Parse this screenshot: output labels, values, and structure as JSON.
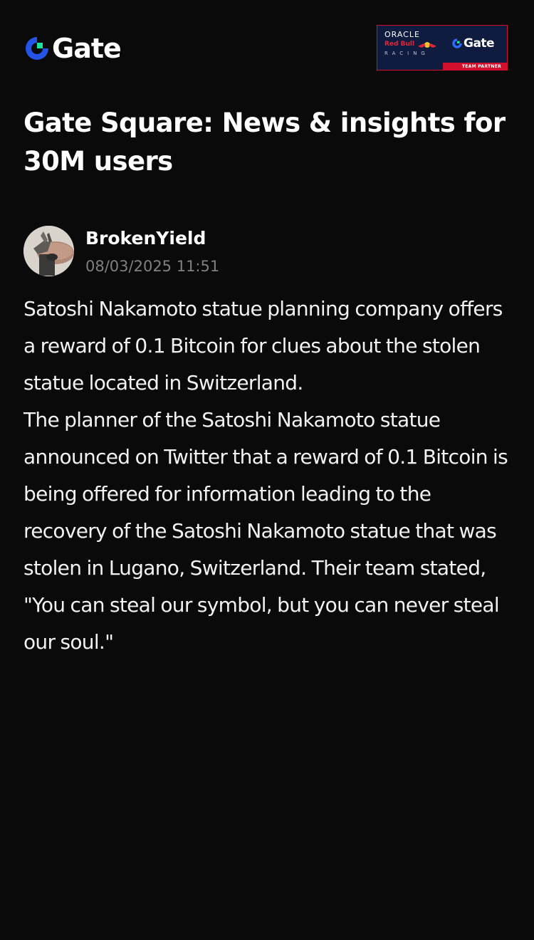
{
  "header": {
    "logo_text": "Gate",
    "logo_icon": "gate-logo-icon",
    "partner": {
      "oracle": "ORACLE",
      "redbull": "Red Bull",
      "racing": "RACING",
      "gate": "Gate",
      "label": "TEAM PARTNER"
    }
  },
  "page": {
    "title": "Gate Square: News & insights for 30M users"
  },
  "post": {
    "author": "BrokenYield",
    "timestamp": "08/03/2025 11:51",
    "paragraphs": [
      "Satoshi Nakamoto statue planning company offers a reward of 0.1 Bitcoin for clues about the stolen statue located in Switzerland.",
      "The planner of the Satoshi Nakamoto statue announced on Twitter that a reward of 0.1 Bitcoin is being offered for information leading to the recovery of the Satoshi Nakamoto statue that was stolen in Lugano, Switzerland. Their team stated, \"You can steal our symbol, but you can never steal our soul.\""
    ]
  },
  "colors": {
    "background": "#0a0a0a",
    "brand_blue": "#2354e6",
    "brand_green": "#17e5a0",
    "muted_text": "#808080",
    "partner_red": "#d0102c",
    "partner_navy": "#0f1c3f"
  }
}
